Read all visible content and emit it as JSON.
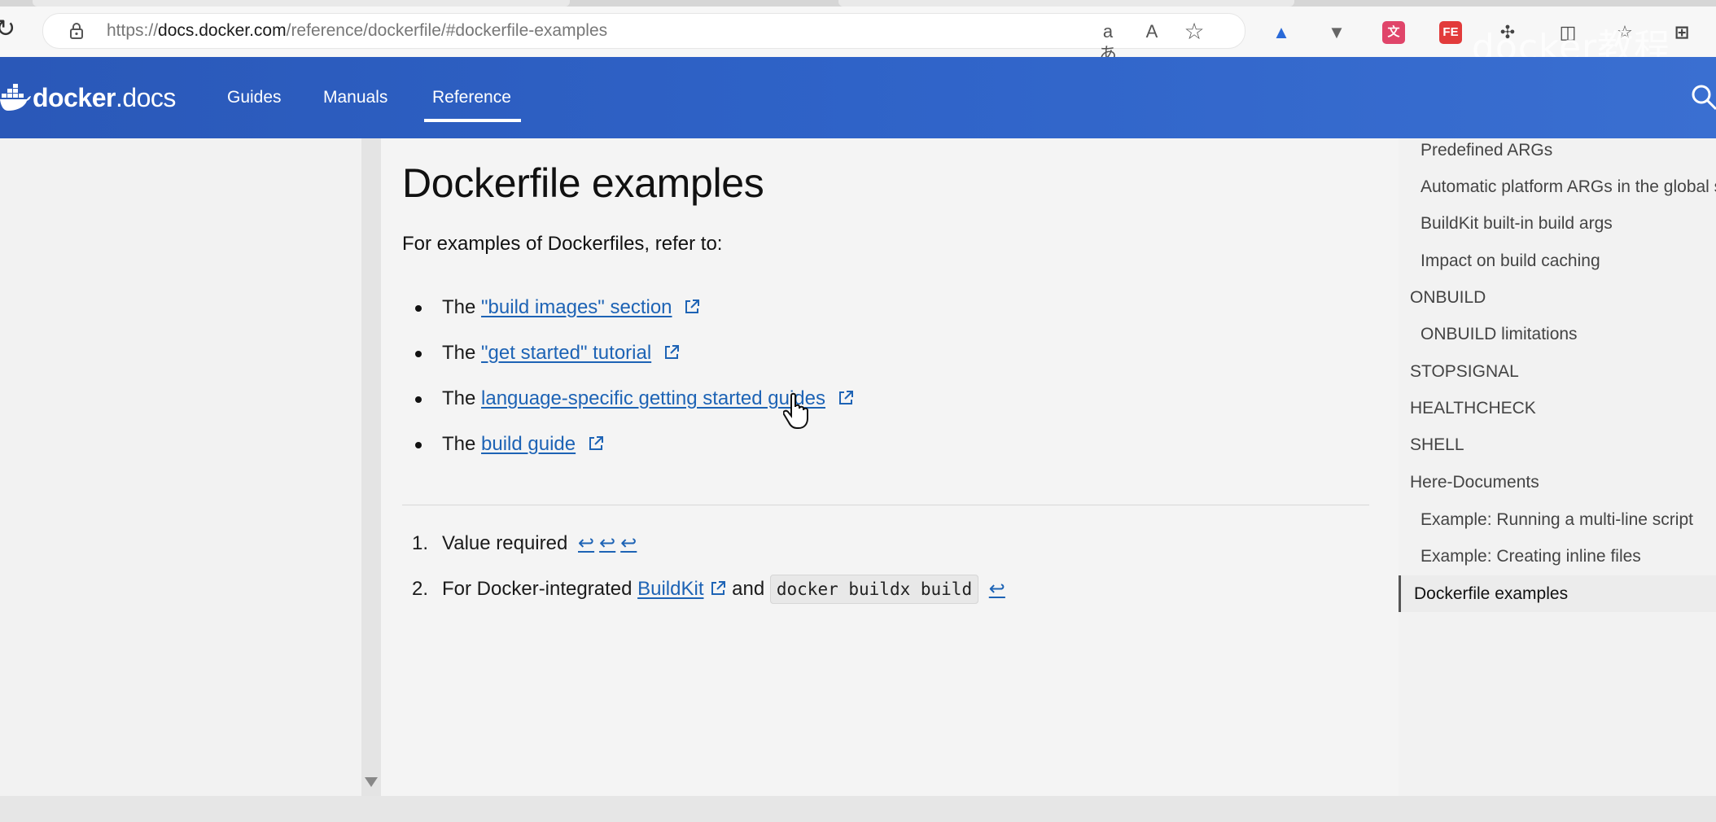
{
  "browser": {
    "url_prefix": "https://",
    "url_host": "docs.docker.com",
    "url_path": "/reference/dockerfile/#dockerfile-examples",
    "watermark": "docker教程"
  },
  "header": {
    "logo_brand": "docker",
    "logo_product": "docs",
    "nav": [
      {
        "label": "Guides"
      },
      {
        "label": "Manuals"
      },
      {
        "label": "Reference"
      }
    ]
  },
  "main": {
    "title": "Dockerfile examples",
    "intro": "For examples of Dockerfiles, refer to:",
    "bullets": [
      {
        "prefix": "The",
        "link": "\"build images\" section"
      },
      {
        "prefix": "The",
        "link": "\"get started\" tutorial"
      },
      {
        "prefix": "The",
        "link": "language-specific getting started guides"
      },
      {
        "prefix": "The",
        "link": "build guide"
      }
    ],
    "footnotes": [
      {
        "num": "1.",
        "text": "Value required",
        "backref": "↩"
      },
      {
        "num": "2.",
        "text": "For Docker-integrated",
        "link": "BuildKit",
        "middle": "and",
        "code": "docker buildx build",
        "backref": "↩"
      }
    ]
  },
  "toc": {
    "items": [
      {
        "label": "Predefined ARGs",
        "level": 2
      },
      {
        "label": "Automatic platform ARGs in the global scope",
        "level": 2
      },
      {
        "label": "BuildKit built-in build args",
        "level": 2
      },
      {
        "label": "Impact on build caching",
        "level": 2
      },
      {
        "label": "ONBUILD",
        "level": 1
      },
      {
        "label": "ONBUILD limitations",
        "level": 2
      },
      {
        "label": "STOPSIGNAL",
        "level": 1
      },
      {
        "label": "HEALTHCHECK",
        "level": 1
      },
      {
        "label": "SHELL",
        "level": 1
      },
      {
        "label": "Here-Documents",
        "level": 1
      },
      {
        "label": "Example: Running a multi-line script",
        "level": 2
      },
      {
        "label": "Example: Creating inline files",
        "level": 2
      },
      {
        "label": "Dockerfile examples",
        "level": 1,
        "active": true
      }
    ]
  },
  "icons": {
    "translate": "aあ",
    "read_aloud": "A",
    "favorite": "☆",
    "reload": "↻"
  },
  "colors": {
    "header_blue": "#2f63c8",
    "link_blue": "#1d63b5"
  }
}
